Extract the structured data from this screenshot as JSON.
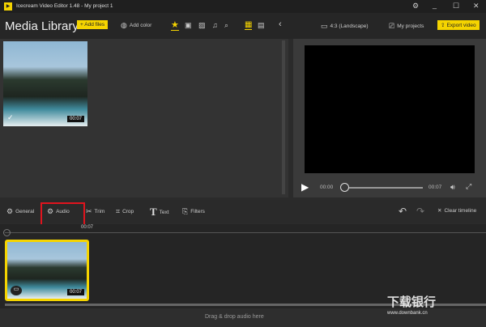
{
  "titlebar": {
    "app_title": "Icecream Video Editor 1.48",
    "separator": "-",
    "project": "My project 1"
  },
  "toolbar": {
    "heading": "Media Library",
    "add_files": "+ Add files",
    "add_color": "Add color",
    "aspect": "4:3 (Landscape)",
    "my_projects": "My projects",
    "export": "Export video"
  },
  "media": {
    "items": [
      {
        "duration": "00:07"
      }
    ]
  },
  "player": {
    "current": "00:00",
    "total": "00:07",
    "progress": 0
  },
  "edit_tools": [
    {
      "label": "General"
    },
    {
      "label": "Audio"
    },
    {
      "label": "Trim"
    },
    {
      "label": "Crop"
    },
    {
      "label": "Text"
    },
    {
      "label": "Filters"
    }
  ],
  "clear_timeline": "Clear timeline",
  "timeline": {
    "marker": "00:07",
    "clip_duration": "00:07",
    "audio_drop": "Drag & drop audio here"
  },
  "watermark": {
    "text": "下载银行",
    "url": "www.downbank.cn"
  },
  "colors": {
    "accent": "#f5d400",
    "highlight": "#e0141e"
  }
}
